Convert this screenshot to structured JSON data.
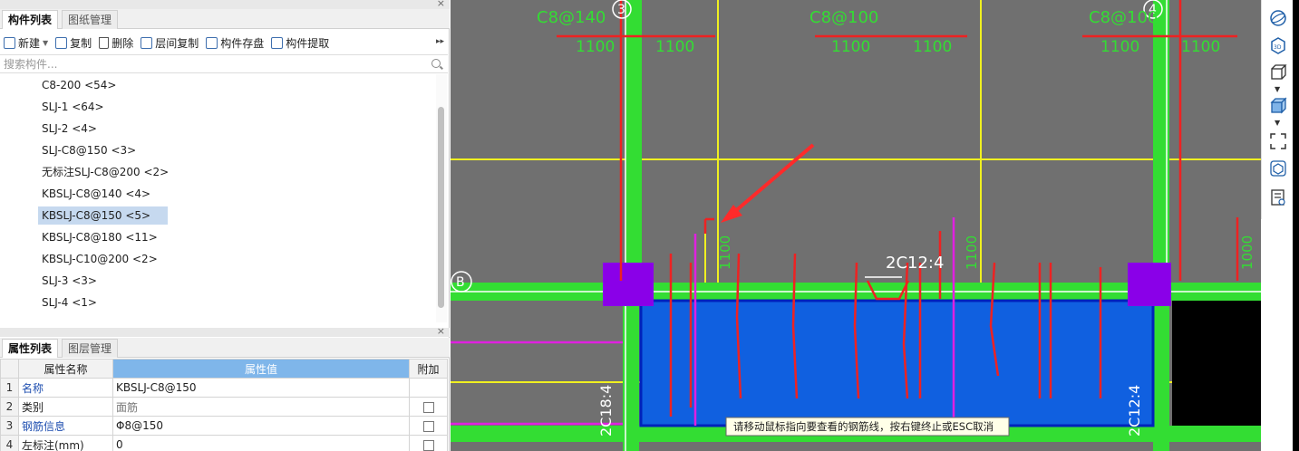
{
  "top_panel": {
    "tabs": [
      "构件列表",
      "图纸管理"
    ],
    "toolbar": {
      "new": "新建",
      "copy": "复制",
      "delete": "删除",
      "floor_copy": "层间复制",
      "save": "构件存盘",
      "extract": "构件提取"
    },
    "search_placeholder": "搜索构件...",
    "items": [
      {
        "label": "C8-200 <54>"
      },
      {
        "label": "SLJ-1 <64>"
      },
      {
        "label": "SLJ-2 <4>"
      },
      {
        "label": "SLJ-C8@150 <3>"
      },
      {
        "label": "无标注SLJ-C8@200 <2>"
      },
      {
        "label": "KBSLJ-C8@140 <4>"
      },
      {
        "label": "KBSLJ-C8@150 <5>",
        "selected": true
      },
      {
        "label": "KBSLJ-C8@180 <11>"
      },
      {
        "label": "KBSLJ-C10@200 <2>"
      },
      {
        "label": "SLJ-3 <3>"
      },
      {
        "label": "SLJ-4 <1>"
      }
    ]
  },
  "bottom_panel": {
    "tabs": [
      "属性列表",
      "图层管理"
    ],
    "headers": {
      "name": "属性名称",
      "value": "属性值",
      "extra": "附加"
    },
    "rows": [
      {
        "num": "1",
        "name": "名称",
        "value": "KBSLJ-C8@150",
        "checkbox": false
      },
      {
        "num": "2",
        "name": "类别",
        "value": "面筋",
        "checkbox": true
      },
      {
        "num": "3",
        "name": "钢筋信息",
        "value": "Φ8@150",
        "checkbox": true
      },
      {
        "num": "4",
        "name": "左标注(mm)",
        "value": "0",
        "checkbox": true
      }
    ]
  },
  "canvas": {
    "grid_labels": {
      "axis3": "3",
      "axis4": "4",
      "axisB": "B"
    },
    "annotations": {
      "top_left": "C8@140",
      "top_mid": "C8@100",
      "top_right": "C8@100",
      "dim": "1100",
      "dim_right": "1000",
      "beam_top": "2C12:4",
      "beam_left": "2C18:4",
      "beam_right": "2C12:4"
    },
    "tooltip": "请移动鼠标指向要查看的钢筋线，按右键终止或ESC取消"
  },
  "colors": {
    "canvas_bg": "#707070",
    "green_beam": "#33dd33",
    "yellow_line": "#f0f020",
    "red_line": "#ee2222",
    "blue_slab": "#1060e0",
    "magenta": "#e020e0",
    "purple_column": "#8a00e8",
    "selection": "#c6d9ef"
  }
}
